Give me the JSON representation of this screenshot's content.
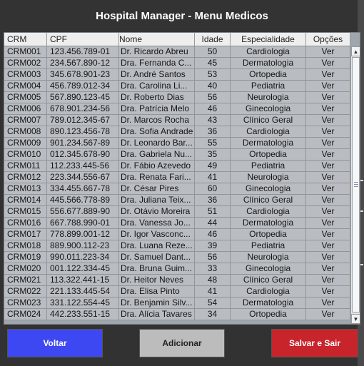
{
  "window": {
    "title": "Hospital Manager - Menu Medicos"
  },
  "table": {
    "columns": [
      "CRM",
      "CPF",
      "Nome",
      "Idade",
      "Especialidade",
      "Opções"
    ],
    "rows": [
      [
        "CRM001",
        "123.456.789-01",
        "Dr. Ricardo Abreu",
        "50",
        "Cardiologia",
        "Ver"
      ],
      [
        "CRM002",
        "234.567.890-12",
        "Dra. Fernanda C...",
        "45",
        "Dermatologia",
        "Ver"
      ],
      [
        "CRM003",
        "345.678.901-23",
        "Dr. André Santos",
        "53",
        "Ortopedia",
        "Ver"
      ],
      [
        "CRM004",
        "456.789.012-34",
        "Dra. Carolina Li...",
        "40",
        "Pediatria",
        "Ver"
      ],
      [
        "CRM005",
        "567.890.123-45",
        "Dr. Roberto Dias",
        "56",
        "Neurologia",
        "Ver"
      ],
      [
        "CRM006",
        "678.901.234-56",
        "Dra. Patrícia Melo",
        "46",
        "Ginecologia",
        "Ver"
      ],
      [
        "CRM007",
        "789.012.345-67",
        "Dr. Marcos Rocha",
        "43",
        "Clínico Geral",
        "Ver"
      ],
      [
        "CRM008",
        "890.123.456-78",
        "Dra. Sofia Andrade",
        "36",
        "Cardiologia",
        "Ver"
      ],
      [
        "CRM009",
        "901.234.567-89",
        "Dr. Leonardo Bar...",
        "55",
        "Dermatologia",
        "Ver"
      ],
      [
        "CRM010",
        "012.345.678-90",
        "Dra. Gabriela Nu...",
        "35",
        "Ortopedia",
        "Ver"
      ],
      [
        "CRM011",
        "112.233.445-56",
        "Dr. Fábio Azevedo",
        "49",
        "Pediatria",
        "Ver"
      ],
      [
        "CRM012",
        "223.344.556-67",
        "Dra. Renata Fari...",
        "41",
        "Neurologia",
        "Ver"
      ],
      [
        "CRM013",
        "334.455.667-78",
        "Dr. César Pires",
        "60",
        "Ginecologia",
        "Ver"
      ],
      [
        "CRM014",
        "445.566.778-89",
        "Dra. Juliana Teix...",
        "36",
        "Clínico Geral",
        "Ver"
      ],
      [
        "CRM015",
        "556.677.889-90",
        "Dr. Otávio Moreira",
        "51",
        "Cardiologia",
        "Ver"
      ],
      [
        "CRM016",
        "667.788.990-01",
        "Dra. Vanessa Jo...",
        "44",
        "Dermatologia",
        "Ver"
      ],
      [
        "CRM017",
        "778.899.001-12",
        "Dr. Igor Vasconc...",
        "46",
        "Ortopedia",
        "Ver"
      ],
      [
        "CRM018",
        "889.900.112-23",
        "Dra. Luana Reze...",
        "39",
        "Pediatria",
        "Ver"
      ],
      [
        "CRM019",
        "990.011.223-34",
        "Dr. Samuel Dant...",
        "56",
        "Neurologia",
        "Ver"
      ],
      [
        "CRM020",
        "001.122.334-45",
        "Dra. Bruna Guim...",
        "33",
        "Ginecologia",
        "Ver"
      ],
      [
        "CRM021",
        "113.322.441-15",
        "Dr. Heitor Neves",
        "48",
        "Clínico Geral",
        "Ver"
      ],
      [
        "CRM022",
        "221.133.445-54",
        "Dra. Elisa Pinto",
        "41",
        "Cardiologia",
        "Ver"
      ],
      [
        "CRM023",
        "331.122.554-45",
        "Dr. Benjamin Silv...",
        "54",
        "Dermatologia",
        "Ver"
      ],
      [
        "CRM024",
        "442.233.551-15",
        "Dra. Alícia Tavares",
        "34",
        "Ortopedia",
        "Ver"
      ]
    ]
  },
  "buttons": {
    "voltar": "Voltar",
    "adicionar": "Adicionar",
    "salvar": "Salvar e Sair"
  },
  "colors": {
    "voltar": "#3e48f2",
    "adicionar": "#bcbcbc",
    "salvar": "#c8242c",
    "row_bg": "#b9bdc2"
  },
  "icons": {
    "scroll_up": "arrow-up-icon",
    "scroll_down": "arrow-down-icon",
    "scroll_grip": "grip-icon"
  }
}
